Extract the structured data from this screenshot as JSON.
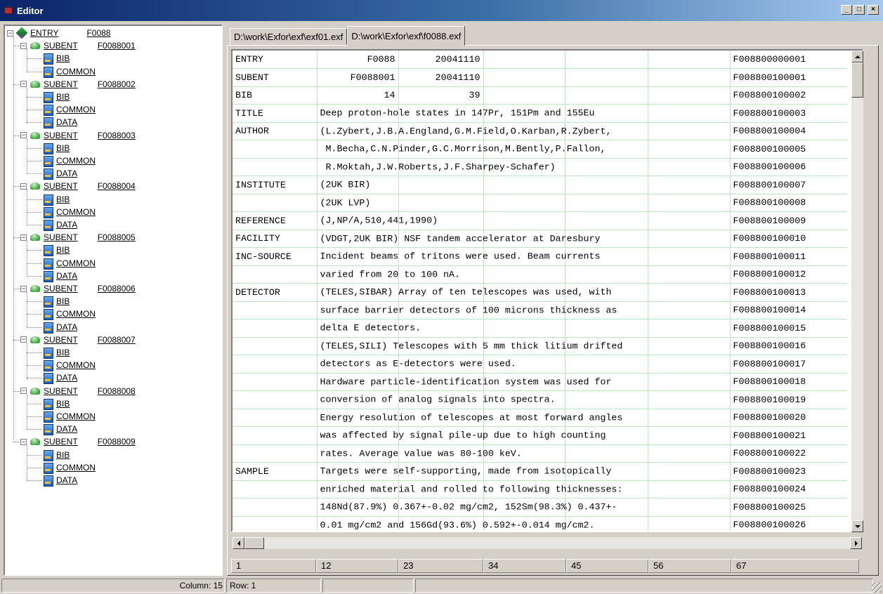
{
  "window": {
    "title": "Editor"
  },
  "tree": {
    "entry": {
      "label": "ENTRY",
      "value": "F0088"
    },
    "subents": [
      {
        "label": "SUBENT",
        "value": "F0088001",
        "children": [
          "BIB",
          "COMMON"
        ]
      },
      {
        "label": "SUBENT",
        "value": "F0088002",
        "children": [
          "BIB",
          "COMMON",
          "DATA"
        ]
      },
      {
        "label": "SUBENT",
        "value": "F0088003",
        "children": [
          "BIB",
          "COMMON",
          "DATA"
        ]
      },
      {
        "label": "SUBENT",
        "value": "F0088004",
        "children": [
          "BIB",
          "COMMON",
          "DATA"
        ]
      },
      {
        "label": "SUBENT",
        "value": "F0088005",
        "children": [
          "BIB",
          "COMMON",
          "DATA"
        ]
      },
      {
        "label": "SUBENT",
        "value": "F0088006",
        "children": [
          "BIB",
          "COMMON",
          "DATA"
        ]
      },
      {
        "label": "SUBENT",
        "value": "F0088007",
        "children": [
          "BIB",
          "COMMON",
          "DATA"
        ]
      },
      {
        "label": "SUBENT",
        "value": "F0088008",
        "children": [
          "BIB",
          "COMMON",
          "DATA"
        ]
      },
      {
        "label": "SUBENT",
        "value": "F0088009",
        "children": [
          "BIB",
          "COMMON",
          "DATA"
        ]
      }
    ]
  },
  "tabs": [
    {
      "label": "D:\\work\\Exfor\\exf\\exf01.exf",
      "active": false
    },
    {
      "label": "D:\\work\\Exfor\\exf\\f0088.exf",
      "active": true
    }
  ],
  "grid": {
    "rows": [
      {
        "kw": "ENTRY",
        "c2": "F0088",
        "c3": "20041110",
        "text": "",
        "id": "F008800000001"
      },
      {
        "kw": "SUBENT",
        "c2": "F0088001",
        "c3": "20041110",
        "text": "",
        "id": "F008800100001"
      },
      {
        "kw": "BIB",
        "c2": "14",
        "c3": "39",
        "text": "",
        "id": "F008800100002"
      },
      {
        "kw": "TITLE",
        "c2": "",
        "c3": "",
        "text": "Deep proton-hole states in 147Pr, 151Pm and 155Eu",
        "id": "F008800100003"
      },
      {
        "kw": "AUTHOR",
        "c2": "",
        "c3": "",
        "text": "(L.Zybert,J.B.A.England,G.M.Field,O.Karban,R.Zybert,",
        "id": "F008800100004"
      },
      {
        "kw": "",
        "c2": "",
        "c3": "",
        "text": " M.Becha,C.N.Pinder,G.C.Morrison,M.Bently,P.Fallon,",
        "id": "F008800100005"
      },
      {
        "kw": "",
        "c2": "",
        "c3": "",
        "text": " R.Moktah,J.W.Roberts,J.F.Sharpey-Schafer)",
        "id": "F008800100006"
      },
      {
        "kw": "INSTITUTE",
        "c2": "",
        "c3": "",
        "text": "(2UK BIR)",
        "id": "F008800100007"
      },
      {
        "kw": "",
        "c2": "",
        "c3": "",
        "text": "(2UK LVP)",
        "id": "F008800100008"
      },
      {
        "kw": "REFERENCE",
        "c2": "",
        "c3": "",
        "text": "(J,NP/A,510,441,1990)",
        "id": "F008800100009"
      },
      {
        "kw": "FACILITY",
        "c2": "",
        "c3": "",
        "text": "(VDGT,2UK BIR) NSF tandem accelerator at Daresbury",
        "id": "F008800100010"
      },
      {
        "kw": "INC-SOURCE",
        "c2": "",
        "c3": "",
        "text": "Incident beams of tritons were used. Beam currents",
        "id": "F008800100011"
      },
      {
        "kw": "",
        "c2": "",
        "c3": "",
        "text": "varied from 20 to 100 nA.",
        "id": "F008800100012"
      },
      {
        "kw": "DETECTOR",
        "c2": "",
        "c3": "",
        "text": "(TELES,SIBAR) Array of ten telescopes was used, with",
        "id": "F008800100013"
      },
      {
        "kw": "",
        "c2": "",
        "c3": "",
        "text": "surface barrier detectors of 100 microns thickness as",
        "id": "F008800100014"
      },
      {
        "kw": "",
        "c2": "",
        "c3": "",
        "text": "delta E detectors.",
        "id": "F008800100015"
      },
      {
        "kw": "",
        "c2": "",
        "c3": "",
        "text": "(TELES,SILI) Telescopes with 5 mm thick litium drifted",
        "id": "F008800100016"
      },
      {
        "kw": "",
        "c2": "",
        "c3": "",
        "text": "detectors as E-detectors were used.",
        "id": "F008800100017"
      },
      {
        "kw": "",
        "c2": "",
        "c3": "",
        "text": "Hardware particle-identification system was used for",
        "id": "F008800100018"
      },
      {
        "kw": "",
        "c2": "",
        "c3": "",
        "text": "conversion of analog signals into spectra.",
        "id": "F008800100019"
      },
      {
        "kw": "",
        "c2": "",
        "c3": "",
        "text": "Energy resolution of telescopes at most forward angles",
        "id": "F008800100020"
      },
      {
        "kw": "",
        "c2": "",
        "c3": "",
        "text": "was affected by signal pile-up due to high counting",
        "id": "F008800100021"
      },
      {
        "kw": "",
        "c2": "",
        "c3": "",
        "text": "rates. Average value was 80-100 keV.",
        "id": "F008800100022"
      },
      {
        "kw": "SAMPLE",
        "c2": "",
        "c3": "",
        "text": "Targets were self-supporting, made from isotopically",
        "id": "F008800100023"
      },
      {
        "kw": "",
        "c2": "",
        "c3": "",
        "text": "enriched material and rolled to following thicknesses:",
        "id": "F008800100024"
      },
      {
        "kw": "",
        "c2": "",
        "c3": "",
        "text": "148Nd(87.9%) 0.367+-0.02 mg/cm2, 152Sm(98.3%) 0.437+-",
        "id": "F008800100025"
      },
      {
        "kw": "",
        "c2": "",
        "c3": "",
        "text": "0.01 mg/cm2 and 156Gd(93.6%) 0.592+-0.014 mg/cm2.",
        "id": "F008800100026"
      }
    ]
  },
  "ruler": [
    "1",
    "12",
    "23",
    "34",
    "45",
    "56",
    "67"
  ],
  "status": {
    "column": "Column: 15",
    "row": "Row: 1"
  }
}
